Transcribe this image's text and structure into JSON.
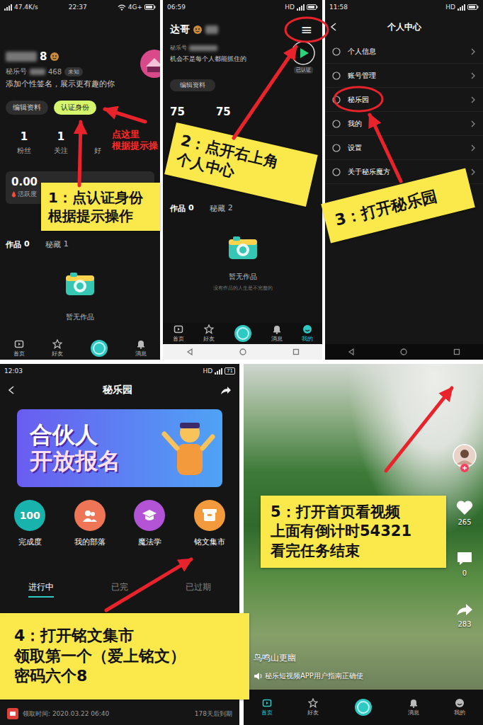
{
  "profile": {
    "status_bar": {
      "speed": "47.4K/s",
      "time": "22:37",
      "network": "4G+"
    },
    "name": "8",
    "id_label": "秘乐号",
    "id_value": "468",
    "gender": "未知",
    "signature": "添加个性签名，展示更有趣的你",
    "buttons": [
      {
        "label": "编辑资料",
        "highlighted": false
      },
      {
        "label": "认证身份",
        "highlighted": true
      }
    ],
    "hint": [
      "点这里",
      "根据提示操"
    ],
    "stats": [
      {
        "value": "1",
        "label": "粉丝"
      },
      {
        "value": "1",
        "label": "关注"
      },
      {
        "label": "好"
      }
    ],
    "activity": {
      "value": "0.00",
      "label": "活跃度"
    },
    "content_tabs": [
      {
        "label": "作品",
        "count": "0",
        "selected": true
      },
      {
        "label": "秘藏",
        "count": "1",
        "selected": false
      }
    ],
    "empty_text": "暂无作品",
    "nav": [
      "首页",
      "好友",
      "消息"
    ],
    "callout": [
      "1：点认证身份",
      "根据提示操作"
    ]
  },
  "personal": {
    "status_bar": {
      "time": "06:59",
      "network": "HD"
    },
    "name": "达哥",
    "menu_icon": "≡",
    "id_label": "秘乐号",
    "signature": "机会不是每个人都能抓住的",
    "verified": "已认证",
    "edit_button": "编辑资料",
    "stats": [
      "75",
      "75"
    ],
    "content_tabs": [
      {
        "label": "作品",
        "count": "0",
        "selected": true
      },
      {
        "label": "秘藏",
        "count": "2",
        "selected": false
      }
    ],
    "empty_text": "暂无作品",
    "empty_sub": "没有作品的人生是不完整的",
    "nav": [
      {
        "label": "首页",
        "selected": false
      },
      {
        "label": "好友",
        "selected": false
      },
      {
        "label": "消息",
        "selected": false
      },
      {
        "label": "我的",
        "selected": true
      }
    ],
    "callout": [
      "2：点开右上角",
      "个人中心"
    ]
  },
  "center": {
    "status_bar": {
      "time": "11:58",
      "network": "HD"
    },
    "title": "个人中心",
    "items": [
      "个人信息",
      "账号管理",
      "秘乐园",
      "我的",
      "设置",
      "关于秘乐魔方"
    ],
    "callout": [
      "3：打开秘乐园"
    ]
  },
  "garden": {
    "status_bar": {
      "time": "12:03",
      "network": "HD",
      "battery": "71"
    },
    "title": "秘乐园",
    "banner": [
      "合伙人",
      "开放报名"
    ],
    "features": [
      {
        "badge": "100",
        "label": "完成度",
        "color": "#19b3ad"
      },
      {
        "label": "我的部落",
        "color": "#ee7656"
      },
      {
        "label": "魔法学",
        "color": "#b354d6"
      },
      {
        "label": "铭文集市",
        "color": "#f29a3c"
      }
    ],
    "tabs": [
      {
        "label": "进行中",
        "selected": true
      },
      {
        "label": "已完",
        "selected": false
      },
      {
        "label": "已过期",
        "selected": false
      }
    ],
    "record": {
      "time": "领取时间: 2020.03.22 06:40",
      "expiry": "178天后到期"
    },
    "callout": [
      "4：打开铭文集市",
      "领取第一个（爱上铭文）",
      "密码六个8"
    ]
  },
  "video": {
    "actions": [
      {
        "kind": "like",
        "count": "265"
      },
      {
        "kind": "comment",
        "count": "0"
      },
      {
        "kind": "share",
        "count": "283"
      }
    ],
    "title": "鸟鸣山更幽",
    "caption": "秘乐短视频APP用户指南正确使",
    "nav": [
      {
        "label": "首页",
        "selected": true
      },
      {
        "label": "好友",
        "selected": false
      },
      {
        "label": "消息",
        "selected": false
      },
      {
        "label": "我的",
        "selected": false
      }
    ],
    "callout": [
      "5：打开首页看视频",
      "上面有倒计时54321",
      "看完任务结束"
    ]
  }
}
